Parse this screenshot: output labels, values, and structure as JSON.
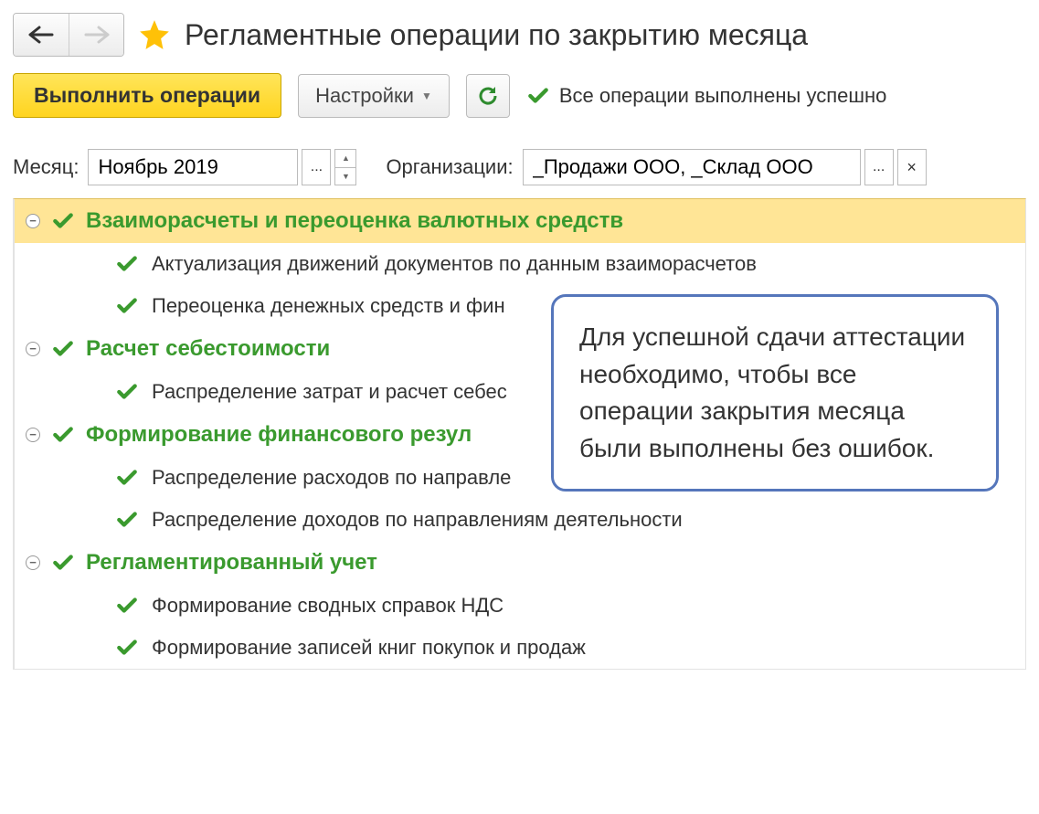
{
  "header": {
    "title": "Регламентные операции по закрытию месяца"
  },
  "toolbar": {
    "execute_label": "Выполнить операции",
    "settings_label": "Настройки",
    "status_text": "Все операции выполнены успешно"
  },
  "filters": {
    "month_label": "Месяц:",
    "month_value": "Ноябрь 2019",
    "org_label": "Организации:",
    "org_value": "_Продажи ООО, _Склад ООО"
  },
  "groups": [
    {
      "title": "Взаиморасчеты и переоценка валютных средств",
      "selected": true,
      "items": [
        "Актуализация движений документов по данным взаиморасчетов",
        "Переоценка денежных средств и фин"
      ]
    },
    {
      "title": "Расчет себестоимости",
      "selected": false,
      "items": [
        "Распределение затрат и расчет себес"
      ]
    },
    {
      "title": "Формирование финансового резул",
      "selected": false,
      "items": [
        "Распределение расходов по направле",
        "Распределение доходов по направлениям деятельности"
      ]
    },
    {
      "title": "Регламентированный учет",
      "selected": false,
      "items": [
        "Формирование сводных справок НДС",
        "Формирование записей книг покупок и продаж"
      ]
    }
  ],
  "callout": {
    "text": "Для успешной сдачи аттестации необходимо, чтобы все операции закрытия месяца были выполнены без ошибок."
  }
}
